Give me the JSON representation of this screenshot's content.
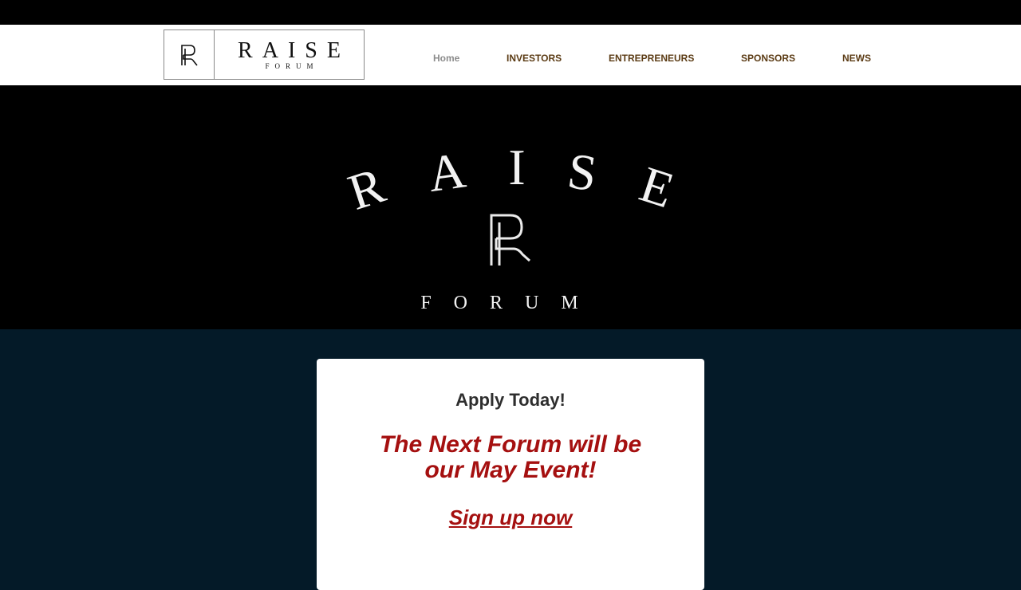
{
  "logo": {
    "monogram": "RF",
    "word": "RAISE",
    "subword": "FORUM"
  },
  "nav": {
    "items": [
      {
        "label": "Home",
        "active": true
      },
      {
        "label": "INVESTORS",
        "active": false
      },
      {
        "label": "ENTREPRENEURS",
        "active": false
      },
      {
        "label": "SPONSORS",
        "active": false
      },
      {
        "label": "NEWS",
        "active": false
      }
    ]
  },
  "hero": {
    "arc_letters": [
      "R",
      "A",
      "I",
      "S",
      "E"
    ],
    "monogram": "RF",
    "bottom_word": "FORUM"
  },
  "card": {
    "heading": "Apply Today!",
    "next_line1": "The Next Forum will be",
    "next_line2": "our May Event!",
    "signup": "Sign up now"
  },
  "colors": {
    "page_background": "#041a28",
    "nav_text": "#5b3b14",
    "nav_active": "#8c8c8c",
    "accent_red": "#a51010"
  }
}
